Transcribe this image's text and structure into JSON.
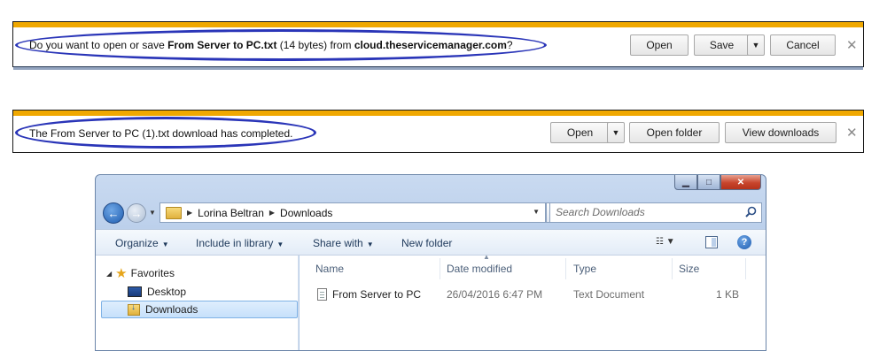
{
  "bar1": {
    "prompt_prefix": "Do you want to open or save ",
    "file_name": "From Server to PC.txt",
    "size_text": " (14 bytes) from ",
    "host": "cloud.theservicemanager.com",
    "prompt_suffix": "?",
    "open_label": "Open",
    "save_label": "Save",
    "cancel_label": "Cancel"
  },
  "bar2": {
    "message": "The From Server to PC (1).txt download has completed.",
    "open_label": "Open",
    "open_folder_label": "Open folder",
    "view_downloads_label": "View downloads"
  },
  "explorer": {
    "breadcrumb": [
      "Lorina Beltran",
      "Downloads"
    ],
    "search_placeholder": "Search Downloads",
    "commands": {
      "organize": "Organize",
      "include_in_library": "Include in library",
      "share_with": "Share with",
      "new_folder": "New folder"
    },
    "nav": {
      "favorites": "Favorites",
      "desktop": "Desktop",
      "downloads": "Downloads"
    },
    "columns": {
      "name": "Name",
      "date_modified": "Date modified",
      "type": "Type",
      "size": "Size"
    },
    "files": [
      {
        "name": "From Server to PC",
        "date_modified": "26/04/2016 6:47 PM",
        "type": "Text Document",
        "size": "1 KB"
      }
    ]
  },
  "colors": {
    "notification_accent": "#f0a800",
    "annotation_oval": "#2a35b8",
    "selection_highlight": "#c6e0fb"
  }
}
